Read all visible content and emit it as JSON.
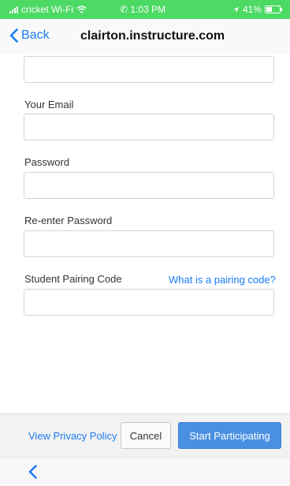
{
  "status_bar": {
    "carrier": "cricket Wi-Fi",
    "time": "1:03 PM",
    "battery": "41%",
    "battery_level": 0.41,
    "icons": [
      "signal-icon",
      "wifi-icon",
      "phone-icon",
      "location-icon",
      "battery-icon"
    ],
    "color": "#4cd964"
  },
  "nav": {
    "back_label": "Back",
    "title": "clairton.instructure.com"
  },
  "form": {
    "top_field_value": "",
    "email_label": "Your Email",
    "email_value": "",
    "password_label": "Password",
    "password_value": "",
    "reenter_label": "Re-enter Password",
    "reenter_value": "",
    "pairing_label": "Student Pairing Code",
    "pairing_help_link": "What is a pairing code?",
    "pairing_value": ""
  },
  "footer": {
    "privacy_link": "View Privacy Policy",
    "cancel_label": "Cancel",
    "start_label": "Start Participating"
  },
  "colors": {
    "accent": "#1a7cf5",
    "primary_button": "#4a90e2"
  }
}
